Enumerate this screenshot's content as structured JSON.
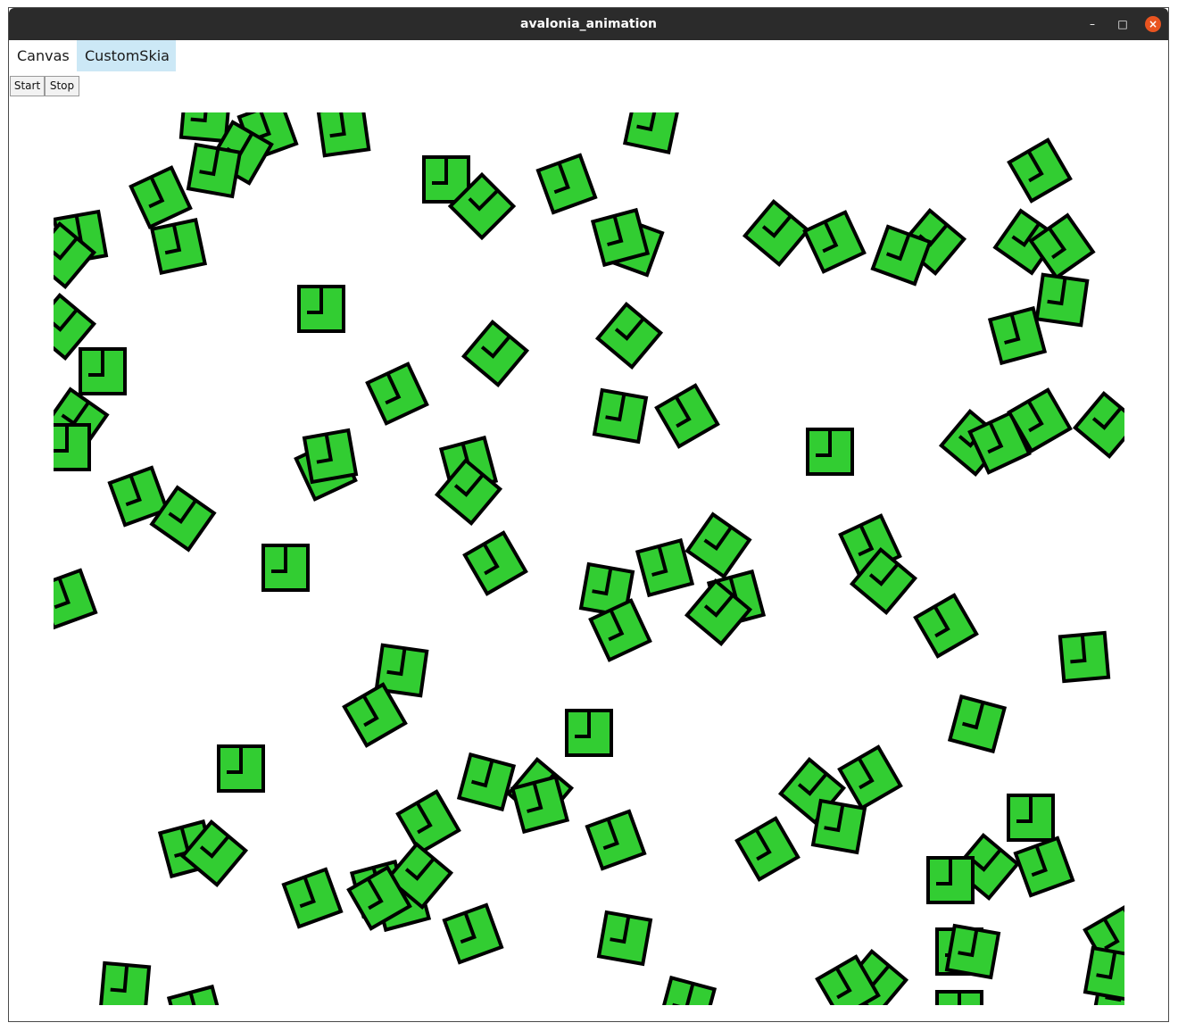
{
  "window": {
    "title": "avalonia_animation",
    "minimize_icon": "–",
    "maximize_icon": "□",
    "close_icon": "×"
  },
  "tabs": [
    {
      "label": "Canvas",
      "selected": false
    },
    {
      "label": "CustomSkia",
      "selected": true
    }
  ],
  "toolbar": {
    "start_label": "Start",
    "stop_label": "Stop"
  },
  "animation": {
    "shape": "square-with-notch",
    "fill_color": "#32cd32",
    "stroke_color": "#000000",
    "shape_count": 120
  }
}
